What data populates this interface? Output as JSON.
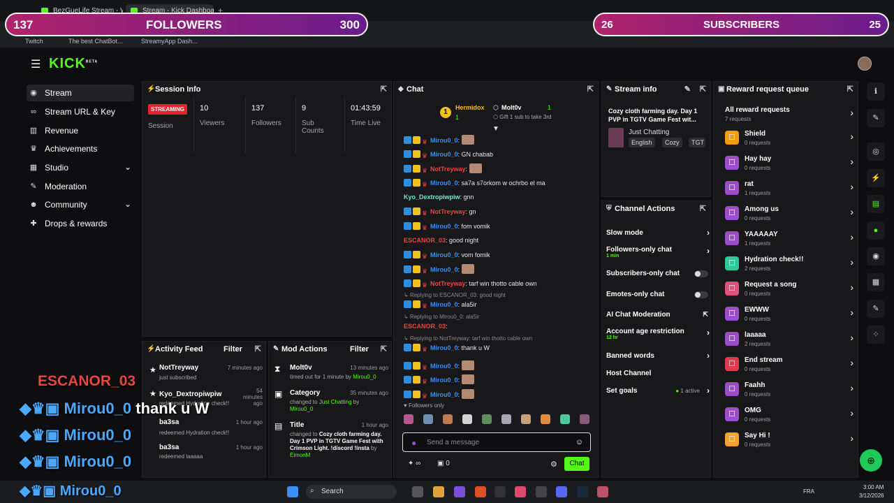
{
  "browser": {
    "tabs": [
      {
        "label": "BezGueLife Stream - Watc"
      },
      {
        "label": "Stream - Kick Dashboard"
      }
    ],
    "bookmarks": [
      "Twitch",
      "The best ChatBot...",
      "StreamyApp Dash..."
    ]
  },
  "overlay": {
    "followers": {
      "current": "137",
      "label": "FOLLOWERS",
      "goal": "300"
    },
    "subscribers": {
      "current": "26",
      "label": "SUBSCRIBERS",
      "goal": "25"
    }
  },
  "logo": {
    "text": "KICK",
    "beta": "BETA"
  },
  "sidebar": {
    "items": [
      {
        "label": "Stream",
        "icon": "broadcast-icon"
      },
      {
        "label": "Stream URL & Key",
        "icon": "link-icon"
      },
      {
        "label": "Revenue",
        "icon": "chart-icon"
      },
      {
        "label": "Achievements",
        "icon": "trophy-icon"
      },
      {
        "label": "Studio",
        "icon": "grid-icon"
      },
      {
        "label": "Moderation",
        "icon": "gavel-icon"
      },
      {
        "label": "Community",
        "icon": "people-icon"
      },
      {
        "label": "Drops & rewards",
        "icon": "gift-icon"
      }
    ]
  },
  "session": {
    "title": "Session Info",
    "status": "STREAMING",
    "status_label": "Session",
    "stats": [
      {
        "value": "10",
        "label": "Viewers"
      },
      {
        "value": "137",
        "label": "Followers"
      },
      {
        "value": "9",
        "label": "Sub Counts"
      },
      {
        "value": "01:43:59",
        "label": "Time Live"
      }
    ]
  },
  "chat": {
    "title": "Chat",
    "pinned": {
      "rank": "1",
      "user1": "Hermidox",
      "user1_count": "1",
      "user2": "Molt0v",
      "user2_count": "1",
      "gift": "Gift 1 sub to take 3rd"
    },
    "messages": [
      {
        "user": "Mirou0_0",
        "text": ":",
        "color": "#3b8ef5",
        "badges": true,
        "thumb": true
      },
      {
        "user": "Mirou0_0",
        "text": ": GN chabab",
        "color": "#3b8ef5",
        "badges": true
      },
      {
        "user": "NotTreyway",
        "text": ":",
        "color": "#e8463f",
        "badges": true,
        "thumb": true
      },
      {
        "user": "Mirou0_0",
        "text": ": sa7a s7orkom w ochrbo el ma",
        "color": "#3b8ef5",
        "badges": true
      },
      {
        "user": "Kyo_Dextropiwpiw",
        "text": ": gnn",
        "color": "#7ee6c8"
      },
      {
        "user": "NotTreyway",
        "text": ": gn",
        "color": "#e8463f",
        "badges": true
      },
      {
        "user": "Mirou0_0",
        "text": ": fom vomik",
        "color": "#3b8ef5",
        "badges": true
      },
      {
        "user": "ESCANOR_03",
        "text": ": good night",
        "color": "#e8463f"
      },
      {
        "user": "Mirou0_0",
        "text": ": vom fomik",
        "color": "#3b8ef5",
        "badges": true
      },
      {
        "user": "Mirou0_0",
        "text": ":",
        "color": "#3b8ef5",
        "badges": true,
        "thumb": true
      },
      {
        "user": "NotTreyway",
        "text": ": tarf win thotto cable own",
        "color": "#e8463f",
        "badges": true
      }
    ],
    "replies": [
      {
        "reply": "Replying to ESCANOR_03: good night",
        "user": "Mirou0_0",
        "text": ": ala5ir"
      },
      {
        "reply": "Replying to Mirou0_0: ala5ir",
        "user": "ESCANOR_03",
        "text": ":"
      },
      {
        "reply": "Replying to NotTreyway: tarf win thotto cable own",
        "user": "Mirou0_0",
        "text": ": thank u W"
      }
    ],
    "tail": [
      "Mirou0_0",
      "Mirou0_0",
      "Mirou0_0"
    ],
    "followers_only": "Followers only",
    "input_placeholder": "Send a message",
    "points": "0",
    "send_label": "Chat"
  },
  "stream_info": {
    "title": "Stream info",
    "stream_title": "Cozy cloth farming day. Day 1 PVP in TGTV Game Fest wit...",
    "category": "Just Chatting",
    "tags": [
      "English",
      "Cozy",
      "TGT"
    ]
  },
  "channel_actions": {
    "title": "Channel Actions",
    "items": [
      {
        "label": "Slow mode",
        "control": "chevron"
      },
      {
        "label": "Followers-only chat",
        "sub": "1 min",
        "control": "chevron"
      },
      {
        "label": "Subscribers-only chat",
        "control": "toggle"
      },
      {
        "label": "Emotes-only chat",
        "control": "toggle"
      },
      {
        "label": "AI Chat Moderation",
        "control": "external"
      },
      {
        "label": "Account age restriction",
        "sub": "12 hr",
        "control": "chevron"
      },
      {
        "label": "Banned words",
        "control": "chevron"
      },
      {
        "label": "Host Channel",
        "control": "none"
      },
      {
        "label": "Set goals",
        "status": "1 active",
        "control": "chevron"
      }
    ]
  },
  "rewards": {
    "title": "Reward request queue",
    "all": {
      "label": "All reward requests",
      "count": "7 requests"
    },
    "items": [
      {
        "label": "Shield",
        "count": "0 requests",
        "color": "#f39c12"
      },
      {
        "label": "Hay hay",
        "count": "0 requests",
        "color": "#9b4dca"
      },
      {
        "label": "rat",
        "count": "1 requests",
        "color": "#9b4dca"
      },
      {
        "label": "Among us",
        "count": "0 requests",
        "color": "#9b4dca"
      },
      {
        "label": "YAAAAAY",
        "count": "1 requests",
        "color": "#9b4dca"
      },
      {
        "label": "Hydration check!!",
        "count": "2 requests",
        "color": "#2ecc9a"
      },
      {
        "label": "Request a song",
        "count": "0 requests",
        "color": "#e0507a"
      },
      {
        "label": "EWWW",
        "count": "0 requests",
        "color": "#9b4dca"
      },
      {
        "label": "laaaaa",
        "count": "2 requests",
        "color": "#9b4dca"
      },
      {
        "label": "End stream",
        "count": "0 requests",
        "color": "#e03a4e"
      },
      {
        "label": "Faahh",
        "count": "0 requests",
        "color": "#9b4dca"
      },
      {
        "label": "OMG",
        "count": "0 requests",
        "color": "#9b4dca"
      },
      {
        "label": "Say Hi !",
        "count": "0 requests",
        "color": "#f3a22d"
      }
    ]
  },
  "activity": {
    "title": "Activity Feed",
    "filter": "Filter",
    "items": [
      {
        "user": "NotTreyway",
        "sub": "just subscribed",
        "time": "7 minutes ago"
      },
      {
        "user": "Kyo_Dextropiwpiw",
        "sub": "redeemed Hydration check!!",
        "time": "54 minutes ago"
      },
      {
        "user": "ba3sa",
        "sub": "redeemed Hydration check!!",
        "time": "1 hour ago"
      },
      {
        "user": "ba3sa",
        "sub": "redeemed laaaaa",
        "time": "1 hour ago"
      }
    ]
  },
  "mod_actions": {
    "title": "Mod Actions",
    "filter": "Filter",
    "items": [
      {
        "user": "Molt0v",
        "sub": "timed out for 1 minute by",
        "by": "Mirou0_0",
        "time": "13 minutes ago"
      },
      {
        "user": "Category",
        "sub": "changed to",
        "value": "Just Chatting",
        "by2": "by",
        "by": "Mirou0_0",
        "time": "35 minutes ago"
      },
      {
        "user": "Title",
        "sub": "changed to",
        "value": "Cozy cloth farming day. Day 1 PVP in TGTV Game Fest with Crimson Light. !discord !insta",
        "by2": "by",
        "by": "EimonM",
        "time": "1 hour ago"
      }
    ]
  },
  "stream_overlay": {
    "escanor": "ESCANOR_03",
    "lines": [
      {
        "user": "Mirou0_0",
        "msg": "thank u W"
      },
      {
        "user": "Mirou0_0",
        "msg": ""
      },
      {
        "user": "Mirou0_0",
        "msg": ""
      },
      {
        "user": "Mirou0_0",
        "msg": ""
      }
    ]
  },
  "taskbar": {
    "search": "Search",
    "lang": "FRA",
    "time": "3:00 AM",
    "date": "3/12/2026"
  },
  "colors": {
    "accent": "#53fc18",
    "streaming": "#e8212e",
    "panel": "#18181b"
  }
}
